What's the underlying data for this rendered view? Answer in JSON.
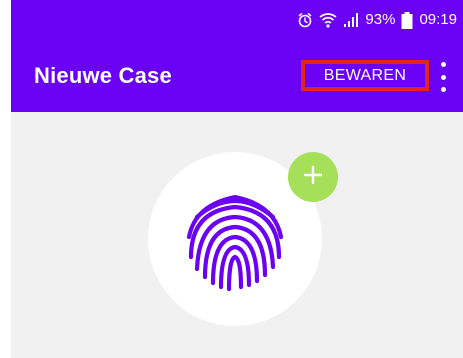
{
  "status_bar": {
    "icons": [
      "alarm-icon",
      "wifi-icon",
      "signal-icon",
      "battery-icon"
    ],
    "battery_percent": "93%",
    "time": "09:19"
  },
  "app_bar": {
    "title": "Nieuwe Case",
    "save_label": "BEWAREN",
    "overflow_icon": "more-vertical-icon"
  },
  "content": {
    "avatar_icon": "fingerprint-icon",
    "add_icon": "plus-icon"
  },
  "colors": {
    "primary": "#6a00f4",
    "accent_green": "#a6e05a",
    "highlight_red": "#e1251b",
    "background": "#f1f1f1"
  }
}
